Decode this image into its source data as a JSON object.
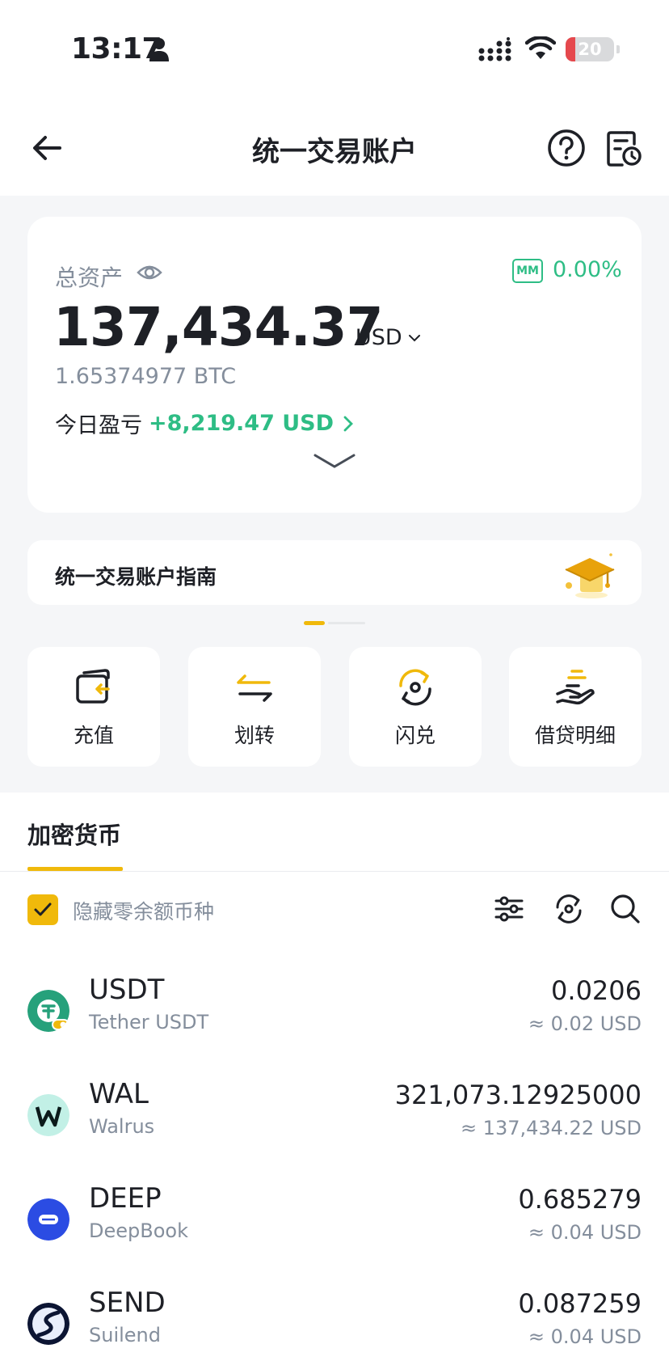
{
  "status_bar": {
    "time": "13:17",
    "battery": "20",
    "battery_level": 0.2
  },
  "header": {
    "title": "统一交易账户"
  },
  "asset_card": {
    "label": "总资产",
    "mm_badge": "MM",
    "mm_value": "0.00%",
    "total": "137,434.37",
    "currency": "USD",
    "btc_equivalent": "1.65374977 BTC",
    "pnl_label": "今日盈亏",
    "pnl_value": "+8,219.47 USD"
  },
  "guide": {
    "title": "统一交易账户指南"
  },
  "actions": [
    {
      "label": "充值",
      "icon": "deposit-icon"
    },
    {
      "label": "划转",
      "icon": "transfer-icon"
    },
    {
      "label": "闪兑",
      "icon": "convert-icon"
    },
    {
      "label": "借贷明细",
      "icon": "loan-details-icon"
    }
  ],
  "tabs": {
    "active": "加密货币"
  },
  "filter": {
    "hide_small_label": "隐藏零余额币种",
    "checked": true
  },
  "coins": [
    {
      "symbol": "USDT",
      "name": "Tether USDT",
      "amount": "0.0206",
      "value": "≈ 0.02 USD",
      "color": "#26a17b",
      "letter": "₮"
    },
    {
      "symbol": "WAL",
      "name": "Walrus",
      "amount": "321,073.12925000",
      "value": "≈ 137,434.22 USD",
      "color": "#c2f0e6",
      "letter": "W"
    },
    {
      "symbol": "DEEP",
      "name": "DeepBook",
      "amount": "0.685279",
      "value": "≈ 0.04 USD",
      "color": "#2b4ce3",
      "letter": ""
    },
    {
      "symbol": "SEND",
      "name": "Suilend",
      "amount": "0.087259",
      "value": "≈ 0.04 USD",
      "color": "#0c1533",
      "letter": ""
    }
  ],
  "colors": {
    "accent": "#f0b90b",
    "positive": "#2ebd85",
    "muted": "#848e9c"
  }
}
